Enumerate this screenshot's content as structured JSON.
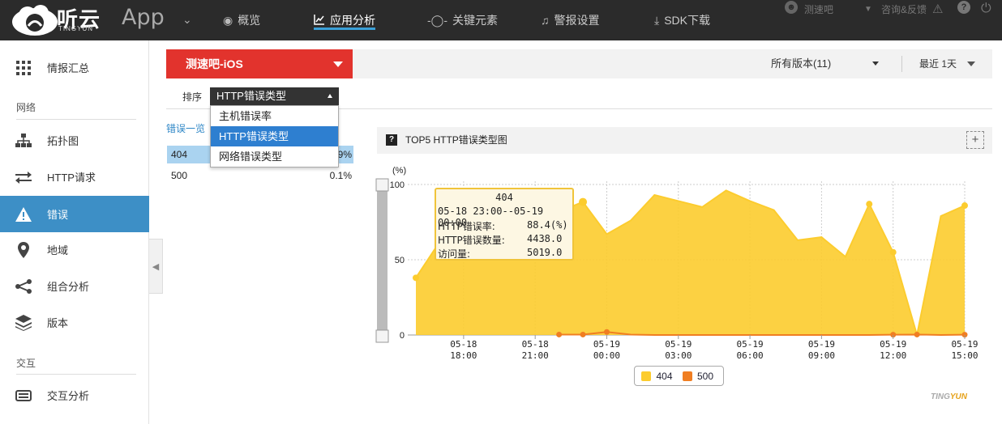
{
  "topbar": {
    "logo_text": "听云",
    "logo_sub": "TINGYUN",
    "app_title": "App",
    "nav": [
      {
        "label": "概览",
        "icon": "overview-icon"
      },
      {
        "label": "应用分析",
        "icon": "line-chart-icon",
        "active": true
      },
      {
        "label": "关键元素",
        "icon": "key-element-icon"
      },
      {
        "label": "警报设置",
        "icon": "bell-icon"
      },
      {
        "label": "SDK下载",
        "icon": "download-icon"
      }
    ],
    "user": "测速吧",
    "feedback": "咨询&反馈"
  },
  "sidebar": {
    "items": [
      {
        "label": "情报汇总",
        "icon": "grid-icon"
      },
      {
        "label": "拓扑图",
        "icon": "topology-icon"
      },
      {
        "label": "HTTP请求",
        "icon": "swap-arrows-icon"
      },
      {
        "label": "错误",
        "icon": "warning-icon",
        "active": true
      },
      {
        "label": "地域",
        "icon": "map-pin-icon"
      },
      {
        "label": "组合分析",
        "icon": "share-nodes-icon"
      },
      {
        "label": "版本",
        "icon": "layers-icon"
      },
      {
        "label": "交互分析",
        "icon": "interaction-icon"
      }
    ],
    "sections": [
      "网络",
      "交互"
    ]
  },
  "main": {
    "app_name": "测速吧-iOS",
    "version_filter": "所有版本(11)",
    "time_filter": "最近  1天",
    "sort_label": "排序",
    "sort_value": "HTTP错误类型",
    "sort_options": [
      "主机错误率",
      "HTTP错误类型",
      "网络错误类型"
    ],
    "error_list_label": "错误一览",
    "error_rows": [
      {
        "code": "404",
        "pct": ".9%",
        "selected": true
      },
      {
        "code": "500",
        "pct": "0.1%",
        "selected": false
      }
    ]
  },
  "chart": {
    "title": "TOP5 HTTP错误类型图",
    "help": "?",
    "expand": "+"
  },
  "tooltip": {
    "title": "404",
    "range": "05-18 23:00--05-19 00:00",
    "rows": [
      {
        "label": "HTTP错误率:",
        "value": "88.4(%)"
      },
      {
        "label": "HTTP错误数量:",
        "value": "4438.0"
      },
      {
        "label": "访问量:",
        "value": "5019.0"
      }
    ]
  },
  "brand": {
    "a": "TING",
    "b": "YUN"
  },
  "colors": {
    "series_404": "#fccc2e",
    "series_500": "#f07e22",
    "accent_red": "#e2332d",
    "active_blue": "#3d8fc6"
  },
  "chart_data": {
    "type": "area",
    "ylabel": "(%)",
    "ylim": [
      0,
      100
    ],
    "yticks": [
      0,
      50,
      100
    ],
    "x_tick_labels": [
      [
        "05-18",
        "18:00"
      ],
      [
        "05-18",
        "21:00"
      ],
      [
        "05-19",
        "00:00"
      ],
      [
        "05-19",
        "03:00"
      ],
      [
        "05-19",
        "06:00"
      ],
      [
        "05-19",
        "09:00"
      ],
      [
        "05-19",
        "12:00"
      ],
      [
        "05-19",
        "15:00"
      ]
    ],
    "x_tick_index": [
      2,
      5,
      8,
      11,
      14,
      17,
      20,
      23
    ],
    "x_count": 24,
    "series": [
      {
        "name": "404",
        "color": "#fccc2e",
        "values": [
          38,
          62,
          82,
          78,
          66,
          64,
          82,
          88.4,
          67,
          76,
          93,
          89,
          85,
          96,
          89,
          83,
          63,
          65,
          52,
          87,
          55,
          0,
          79,
          86
        ]
      },
      {
        "name": "500",
        "color": "#f07e22",
        "values": [
          null,
          null,
          null,
          null,
          null,
          null,
          0.3,
          0.3,
          2,
          0.3,
          0,
          0,
          0,
          0,
          0,
          0,
          0,
          0,
          0,
          0,
          0.2,
          0.3,
          0,
          0.2
        ]
      }
    ],
    "legend": [
      "404",
      "500"
    ]
  }
}
